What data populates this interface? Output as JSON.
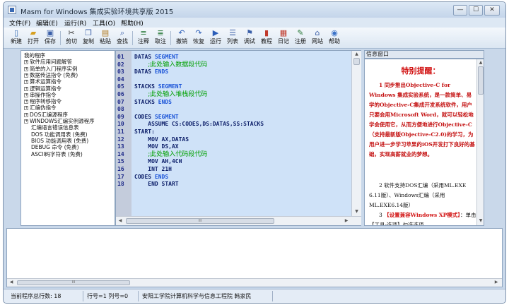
{
  "window": {
    "title": "Masm for Windows 集成实验环境共享版 2015",
    "controls": {
      "minimize": "—",
      "maximize": "☐",
      "close": "✕"
    }
  },
  "menu": [
    "文件(F)",
    "编辑(E)",
    "运行(R)",
    "工具(O)",
    "帮助(H)"
  ],
  "toolbar": [
    {
      "label": "新建",
      "icon": "new-file-icon",
      "glyph": "▯",
      "color": "#3b6fb5"
    },
    {
      "label": "打开",
      "icon": "open-folder-icon",
      "glyph": "▰",
      "color": "#d7a022"
    },
    {
      "label": "保存",
      "icon": "save-icon",
      "glyph": "▣",
      "color": "#3a5fa8"
    },
    {
      "label": "剪切",
      "icon": "cut-icon",
      "glyph": "✂",
      "color": "#333333"
    },
    {
      "label": "复制",
      "icon": "copy-icon",
      "glyph": "❐",
      "color": "#3a5fa8"
    },
    {
      "label": "粘贴",
      "icon": "paste-icon",
      "glyph": "▤",
      "color": "#b07a20"
    },
    {
      "label": "查找",
      "icon": "find-icon",
      "glyph": "⌕",
      "color": "#3a5fa8"
    },
    {
      "label": "注释",
      "icon": "comment-icon",
      "glyph": "≡",
      "color": "#2a7a3a"
    },
    {
      "label": "取注",
      "icon": "uncomment-icon",
      "glyph": "≣",
      "color": "#2a7a3a"
    },
    {
      "label": "撤销",
      "icon": "undo-icon",
      "glyph": "↶",
      "color": "#2a5db8"
    },
    {
      "label": "恢复",
      "icon": "redo-icon",
      "glyph": "↷",
      "color": "#2a5db8"
    },
    {
      "label": "运行",
      "icon": "run-icon",
      "glyph": "▶",
      "color": "#2a5db8"
    },
    {
      "label": "列表",
      "icon": "list-icon",
      "glyph": "☰",
      "color": "#3a5fa8"
    },
    {
      "label": "调试",
      "icon": "debug-icon",
      "glyph": "⚑",
      "color": "#3a5fa8"
    },
    {
      "label": "教程",
      "icon": "tutorial-icon",
      "glyph": "▮",
      "color": "#c0392b"
    },
    {
      "label": "日记",
      "icon": "diary-icon",
      "glyph": "▦",
      "color": "#c0392b"
    },
    {
      "label": "注册",
      "icon": "register-icon",
      "glyph": "✎",
      "color": "#2a7a3a"
    },
    {
      "label": "网站",
      "icon": "website-icon",
      "glyph": "⌂",
      "color": "#3a5fa8"
    },
    {
      "label": "帮助",
      "icon": "help-icon",
      "glyph": "◉",
      "color": "#3a72c8"
    }
  ],
  "tree": [
    {
      "label": "我的程序",
      "pm": ""
    },
    {
      "label": "软件应用问题解答",
      "pm": "+"
    },
    {
      "label": "简单的入门程序实例",
      "pm": "+"
    },
    {
      "label": "数据传送指令 (免费)",
      "pm": "+"
    },
    {
      "label": "算术运算指令",
      "pm": "+"
    },
    {
      "label": "逻辑运算指令",
      "pm": "+"
    },
    {
      "label": "串操作指令",
      "pm": "+"
    },
    {
      "label": "程序转移指令",
      "pm": "+"
    },
    {
      "label": "汇编伪指令",
      "pm": "+"
    },
    {
      "label": "DOS汇编源程序",
      "pm": "+"
    },
    {
      "label": "WINDOWS汇编实例源程序",
      "pm": "+"
    },
    {
      "label": "汇编语言错误信息表",
      "pm": ""
    },
    {
      "label": "DOS 功能调用表 (免费)",
      "pm": ""
    },
    {
      "label": "BIOS 功能调用表 (免费)",
      "pm": ""
    },
    {
      "label": "DEBUG 命令 (免费)",
      "pm": ""
    },
    {
      "label": "ASCII码字符表 (免费)",
      "pm": ""
    }
  ],
  "editor": {
    "lines": [
      {
        "num": "01",
        "code": "DATAS ",
        "kw": "SEGMENT",
        "comment": ""
      },
      {
        "num": "02",
        "code": "    ",
        "kw": "",
        "comment": ";此处输入数据段代码"
      },
      {
        "num": "03",
        "code": "DATAS ",
        "kw": "ENDS",
        "comment": ""
      },
      {
        "num": "04",
        "code": "",
        "kw": "",
        "comment": ""
      },
      {
        "num": "05",
        "code": "STACKS ",
        "kw": "SEGMENT",
        "comment": ""
      },
      {
        "num": "06",
        "code": "    ",
        "kw": "",
        "comment": ";此处输入堆栈段代码"
      },
      {
        "num": "07",
        "code": "STACKS ",
        "kw": "ENDS",
        "comment": ""
      },
      {
        "num": "08",
        "code": "",
        "kw": "",
        "comment": ""
      },
      {
        "num": "09",
        "code": "CODES ",
        "kw": "SEGMENT",
        "comment": ""
      },
      {
        "num": "10",
        "code": "    ASSUME CS:CODES,DS:DATAS,SS:STACKS",
        "kw": "",
        "comment": ""
      },
      {
        "num": "11",
        "code": "START:",
        "kw": "",
        "comment": ""
      },
      {
        "num": "12",
        "code": "    MOV AX,DATAS",
        "kw": "",
        "comment": ""
      },
      {
        "num": "13",
        "code": "    MOV DS,AX",
        "kw": "",
        "comment": ""
      },
      {
        "num": "14",
        "code": "    ",
        "kw": "",
        "comment": ";此处输入代码段代码"
      },
      {
        "num": "15",
        "code": "    MOV AH,4CH",
        "kw": "",
        "comment": ""
      },
      {
        "num": "16",
        "code": "    INT 21H",
        "kw": "",
        "comment": ""
      },
      {
        "num": "17",
        "code": "CODES ",
        "kw": "ENDS",
        "comment": ""
      },
      {
        "num": "18",
        "code": "    END START",
        "kw": "",
        "comment": ""
      }
    ],
    "scroll_mark": "III"
  },
  "info": {
    "title": "信息窗口",
    "heading": "特别提醒：",
    "para1": "1 同步推出Objective-C for Windows 集成实验系统，是一款简单、易学的Objective-C集成开发系统软件，用户只要会用Microsoft Word，就可以轻松地学会使用它，从而方便地进行Objective-C（支持最新版Objective-C2.0)的学习，为用户进一步学习苹果的iOS开发打下良好的基础，实现高薪就业的梦想。",
    "para2": "2 软件支持DOS汇编（采用ML.EXE 6.11版）、Windows汇编（采用ML.EXE6.14版）",
    "para3_num": "3",
    "para3_hl": "【设置兼容Windows XP模式】",
    "para3_rest": "：单击【工具-选项】勾选选项"
  },
  "output": {
    "scroll_mark": "III"
  },
  "status": {
    "total_lines": "当前程序总行数:  18",
    "row_col": "行号=1  列号=0",
    "author": "安阳工学院计算机科学与信息工程院  韩家民"
  }
}
